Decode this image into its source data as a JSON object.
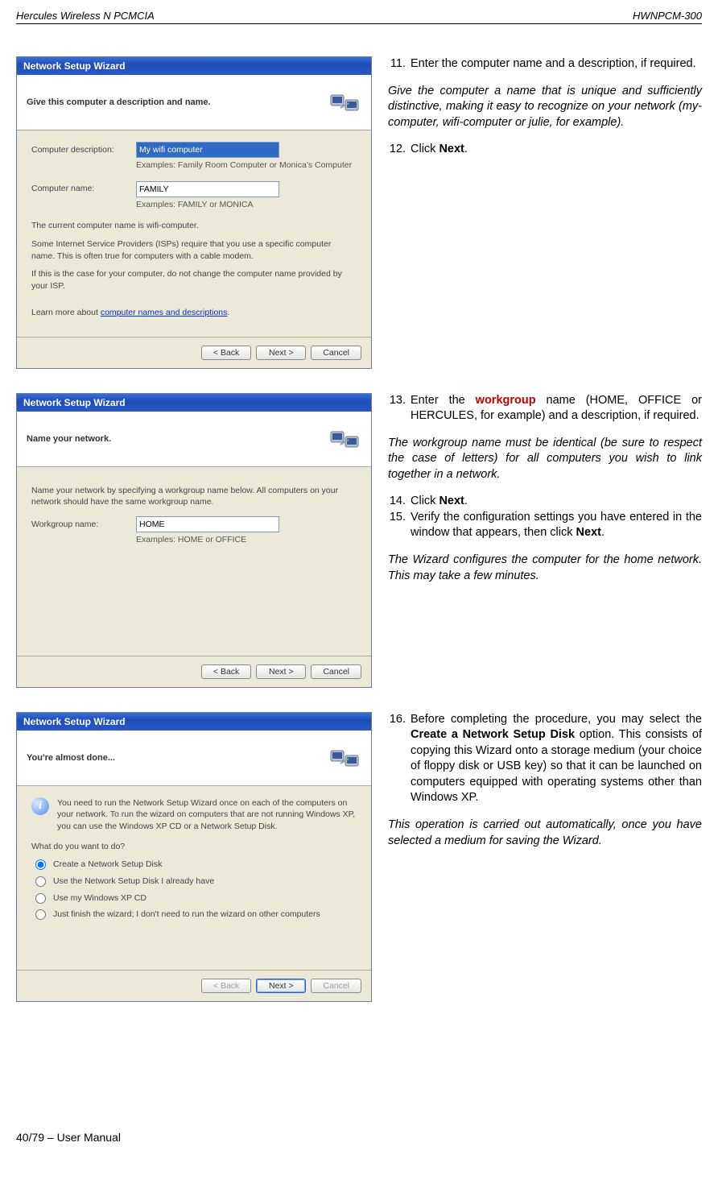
{
  "header": {
    "left": "Hercules Wireless N PCMCIA",
    "right": "HWNPCM-300"
  },
  "footer": "40/79 – User Manual",
  "wizard1": {
    "title": "Network Setup Wizard",
    "heading": "Give this computer a description and name.",
    "desc_label": "Computer description:",
    "desc_value": "My wifi computer",
    "desc_examples": "Examples: Family Room Computer or Monica's Computer",
    "name_label": "Computer name:",
    "name_value": "FAMILY",
    "name_examples": "Examples: FAMILY or MONICA",
    "line1": "The current computer name is wifi-computer.",
    "line2": "Some Internet Service Providers (ISPs) require that you use a specific computer name. This is often true for computers with a cable modem.",
    "line3": "If this is the case for your computer, do not change the computer name provided by your ISP.",
    "learn_prefix": "Learn more about ",
    "learn_link": "computer names and descriptions",
    "btn_back": "< Back",
    "btn_next": "Next >",
    "btn_cancel": "Cancel"
  },
  "wizard2": {
    "title": "Network Setup Wizard",
    "heading": "Name your network.",
    "intro": "Name your network by specifying a workgroup name below. All computers on your network should have the same workgroup name.",
    "wg_label": "Workgroup name:",
    "wg_value": "HOME",
    "wg_examples": "Examples: HOME or OFFICE",
    "btn_back": "< Back",
    "btn_next": "Next >",
    "btn_cancel": "Cancel"
  },
  "wizard3": {
    "title": "Network Setup Wizard",
    "heading": "You're almost done...",
    "info": "You need to run the Network Setup Wizard once on each of the computers on your network. To run the wizard on computers that are not running Windows XP, you can use the Windows XP CD or a Network Setup Disk.",
    "question": "What do you want to do?",
    "opt1": "Create a Network Setup Disk",
    "opt2": "Use the Network Setup Disk I already have",
    "opt3": "Use my Windows XP CD",
    "opt4": "Just finish the wizard; I don't need to run the wizard on other computers",
    "btn_back": "< Back",
    "btn_next": "Next >",
    "btn_cancel": "Cancel"
  },
  "instructions": {
    "step11": "Enter the computer name and a description, if required.",
    "note11": "Give the computer a name that is unique and sufficiently distinctive, making it easy to recognize on your network (my-computer, wifi-computer or julie, for example).",
    "step12_prefix": "Click ",
    "step12_bold": "Next",
    "step12_suffix": ".",
    "step13_prefix": "Enter the ",
    "step13_workgroup": "workgroup",
    "step13_suffix": " name (HOME, OFFICE or HERCULES, for example) and a description, if required.",
    "note13": "The workgroup name must be identical (be sure to respect the case of letters) for all computers you wish to link together in a network.",
    "step14_prefix": "Click ",
    "step14_bold": "Next",
    "step14_suffix": ".",
    "step15_prefix": "Verify the configuration settings you have entered in the window that appears, then click ",
    "step15_bold": "Next",
    "step15_suffix": ".",
    "note15": "The Wizard configures the computer for the home network.  This may take a few minutes.",
    "step16_prefix": "Before completing the procedure, you may select the ",
    "step16_bold": "Create a Network Setup Disk",
    "step16_suffix": " option.  This consists of copying this Wizard onto a storage medium (your choice of floppy disk or USB key) so that it can be launched on computers equipped with operating systems other than Windows XP.",
    "note16": "This operation is carried out automatically, once you have selected a medium for saving the Wizard."
  }
}
